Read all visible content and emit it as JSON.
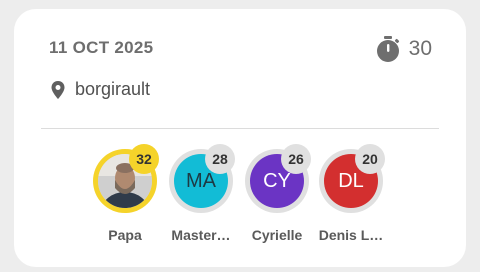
{
  "event": {
    "date": "11 OCT 2025",
    "timer_icon": "stopwatch-icon",
    "duration": "30",
    "location_icon": "map-pin-icon",
    "location": "borgirault"
  },
  "participants": [
    {
      "name": "Papa",
      "initials": "",
      "score": "32",
      "avatar": "photo",
      "ring_color": "#f5d32a",
      "badge_color": "#f5d32a"
    },
    {
      "name": "Master…",
      "initials": "MA",
      "score": "28",
      "avatar_color": "#12bcd6",
      "ring_color": "#e0e0e0",
      "badge_color": "#e0e0e0"
    },
    {
      "name": "Cyrielle",
      "initials": "CY",
      "score": "26",
      "avatar_color": "#6b34c4",
      "ring_color": "#e0e0e0",
      "badge_color": "#e0e0e0"
    },
    {
      "name": "Denis L…",
      "initials": "DL",
      "score": "20",
      "avatar_color": "#d32f2f",
      "ring_color": "#e0e0e0",
      "badge_color": "#e0e0e0"
    }
  ],
  "colors": {
    "text_primary": "#6e6e6e",
    "card_background": "#ffffff",
    "page_background": "#ededed"
  }
}
